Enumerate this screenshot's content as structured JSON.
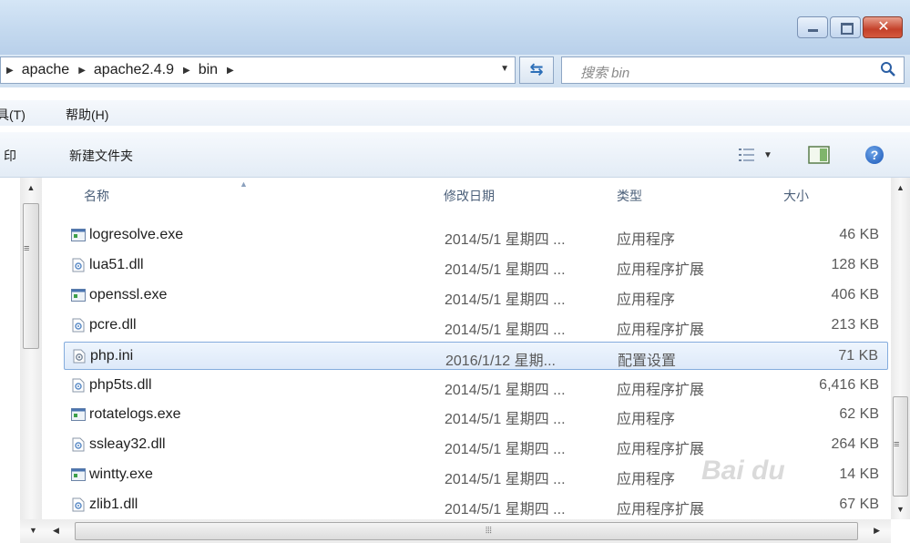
{
  "window": {
    "minimize_icon": "minimize-icon",
    "maximize_icon": "maximize-icon",
    "close_icon": "close-icon"
  },
  "address": {
    "crumbs": [
      "apache",
      "apache2.4.9",
      "bin"
    ],
    "search_placeholder": "搜索 bin"
  },
  "menu": {
    "tools": "具(T)",
    "help": "帮助(H)"
  },
  "toolbar": {
    "print": "印",
    "new_folder": "新建文件夹"
  },
  "columns": {
    "name": "名称",
    "date": "修改日期",
    "type": "类型",
    "size": "大小"
  },
  "files": [
    {
      "name": "logresolve.exe",
      "date": "2014/5/1 星期四 ...",
      "type": "应用程序",
      "size": "46 KB",
      "icon": "exe-icon"
    },
    {
      "name": "lua51.dll",
      "date": "2014/5/1 星期四 ...",
      "type": "应用程序扩展",
      "size": "128 KB",
      "icon": "dll-icon"
    },
    {
      "name": "openssl.exe",
      "date": "2014/5/1 星期四 ...",
      "type": "应用程序",
      "size": "406 KB",
      "icon": "exe-icon"
    },
    {
      "name": "pcre.dll",
      "date": "2014/5/1 星期四 ...",
      "type": "应用程序扩展",
      "size": "213 KB",
      "icon": "dll-icon"
    },
    {
      "name": "php.ini",
      "date": "2016/1/12 星期...",
      "type": "配置设置",
      "size": "71 KB",
      "icon": "ini-icon",
      "selected": true
    },
    {
      "name": "php5ts.dll",
      "date": "2014/5/1 星期四 ...",
      "type": "应用程序扩展",
      "size": "6,416 KB",
      "icon": "dll-icon"
    },
    {
      "name": "rotatelogs.exe",
      "date": "2014/5/1 星期四 ...",
      "type": "应用程序",
      "size": "62 KB",
      "icon": "exe-icon"
    },
    {
      "name": "ssleay32.dll",
      "date": "2014/5/1 星期四 ...",
      "type": "应用程序扩展",
      "size": "264 KB",
      "icon": "dll-icon"
    },
    {
      "name": "wintty.exe",
      "date": "2014/5/1 星期四 ...",
      "type": "应用程序",
      "size": "14 KB",
      "icon": "exe-icon"
    },
    {
      "name": "zlib1.dll",
      "date": "2014/5/1 星期四 ...",
      "type": "应用程序扩展",
      "size": "67 KB",
      "icon": "dll-icon"
    }
  ],
  "colors": {
    "selection_border": "#84acdd",
    "selection_fill": "#dde9f9",
    "header_text": "#4c607a",
    "close_red": "#c4412a"
  }
}
